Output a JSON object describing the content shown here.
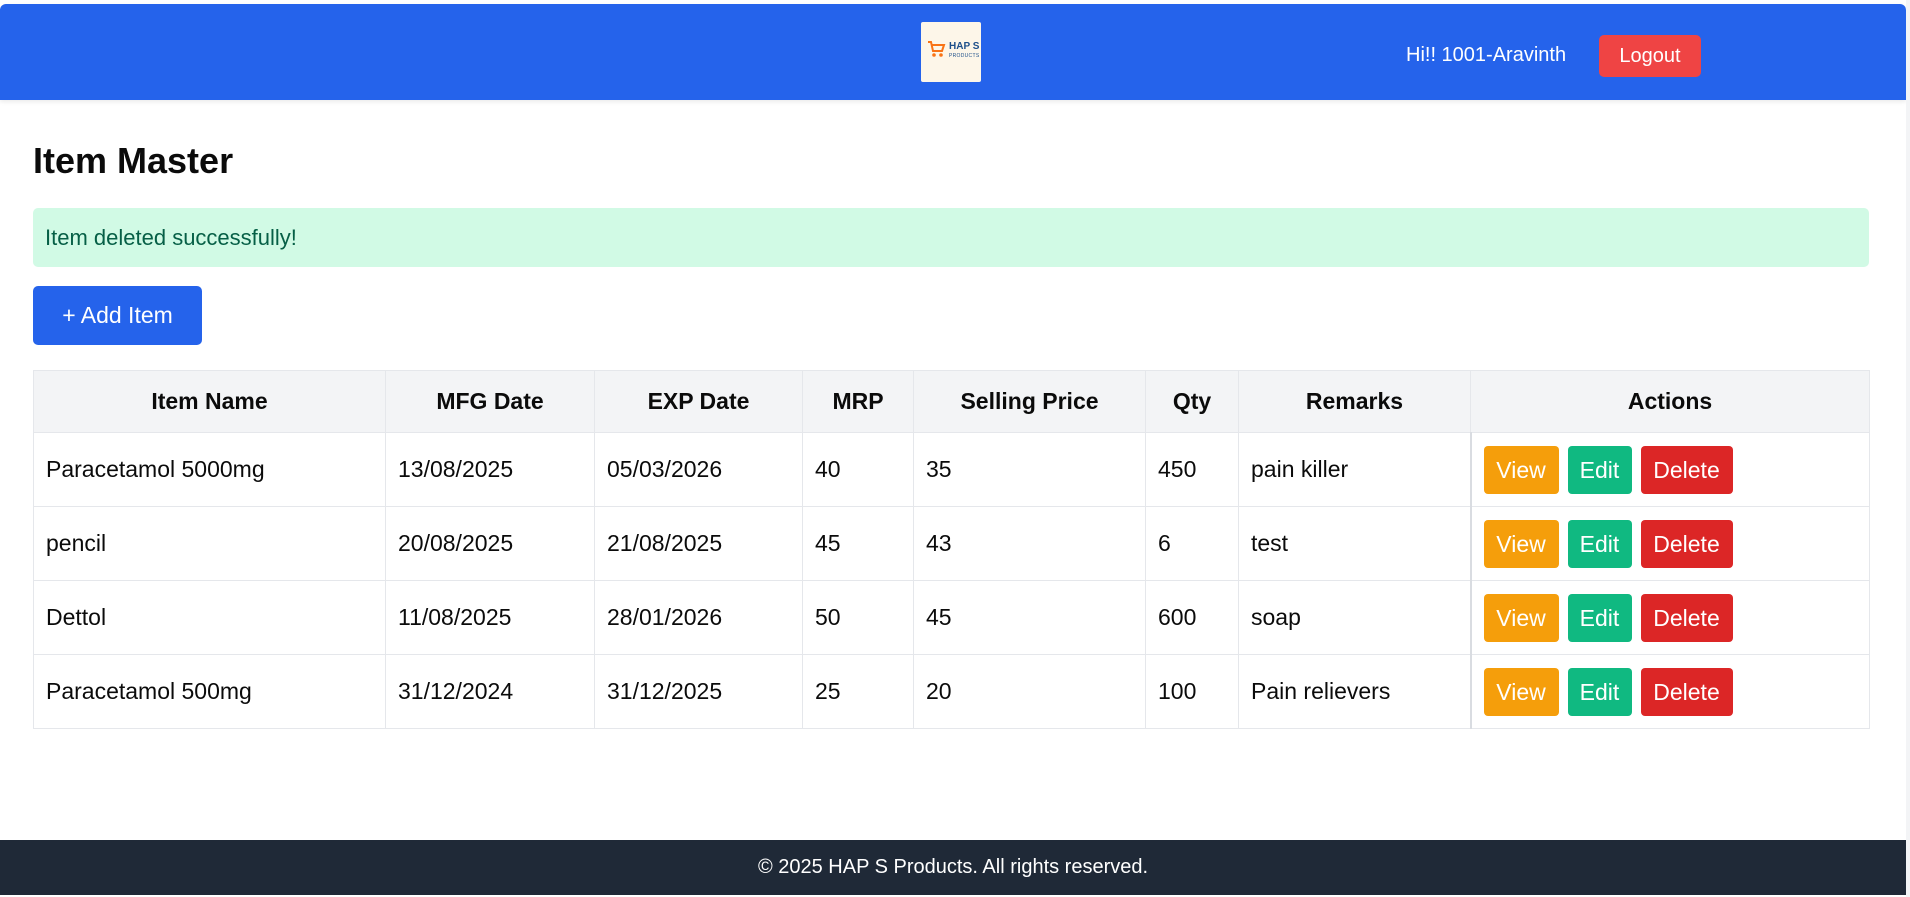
{
  "header": {
    "logo_text": "HAP S",
    "logo_subtext": "PRODUCTS",
    "greeting": "Hi!! 1001-Aravinth",
    "logout_label": "Logout"
  },
  "main": {
    "title": "Item Master",
    "alert": "Item deleted successfully!",
    "add_button": "+ Add Item"
  },
  "table": {
    "columns": [
      "Item Name",
      "MFG Date",
      "EXP Date",
      "MRP",
      "Selling Price",
      "Qty",
      "Remarks",
      "Actions"
    ],
    "rows": [
      {
        "name": "Paracetamol 5000mg",
        "mfg": "13/08/2025",
        "exp": "05/03/2026",
        "mrp": "40",
        "price": "35",
        "qty": "450",
        "remarks": "pain killer"
      },
      {
        "name": "pencil",
        "mfg": "20/08/2025",
        "exp": "21/08/2025",
        "mrp": "45",
        "price": "43",
        "qty": "6",
        "remarks": "test"
      },
      {
        "name": "Dettol",
        "mfg": "11/08/2025",
        "exp": "28/01/2026",
        "mrp": "50",
        "price": "45",
        "qty": "600",
        "remarks": "soap"
      },
      {
        "name": "Paracetamol 500mg",
        "mfg": "31/12/2024",
        "exp": "31/12/2025",
        "mrp": "25",
        "price": "20",
        "qty": "100",
        "remarks": "Pain relievers"
      }
    ],
    "actions": {
      "view": "View",
      "edit": "Edit",
      "delete": "Delete"
    }
  },
  "footer": {
    "text": "© 2025 HAP S Products. All rights reserved."
  },
  "colors": {
    "header": "#2563eb",
    "logout": "#ef4444",
    "alert_bg": "#d1fae5",
    "alert_text": "#065f46",
    "view": "#f59e0b",
    "edit": "#10b981",
    "delete": "#dc2626",
    "footer": "#1f2937"
  },
  "icons": {
    "logo": "shopping-cart-icon"
  }
}
